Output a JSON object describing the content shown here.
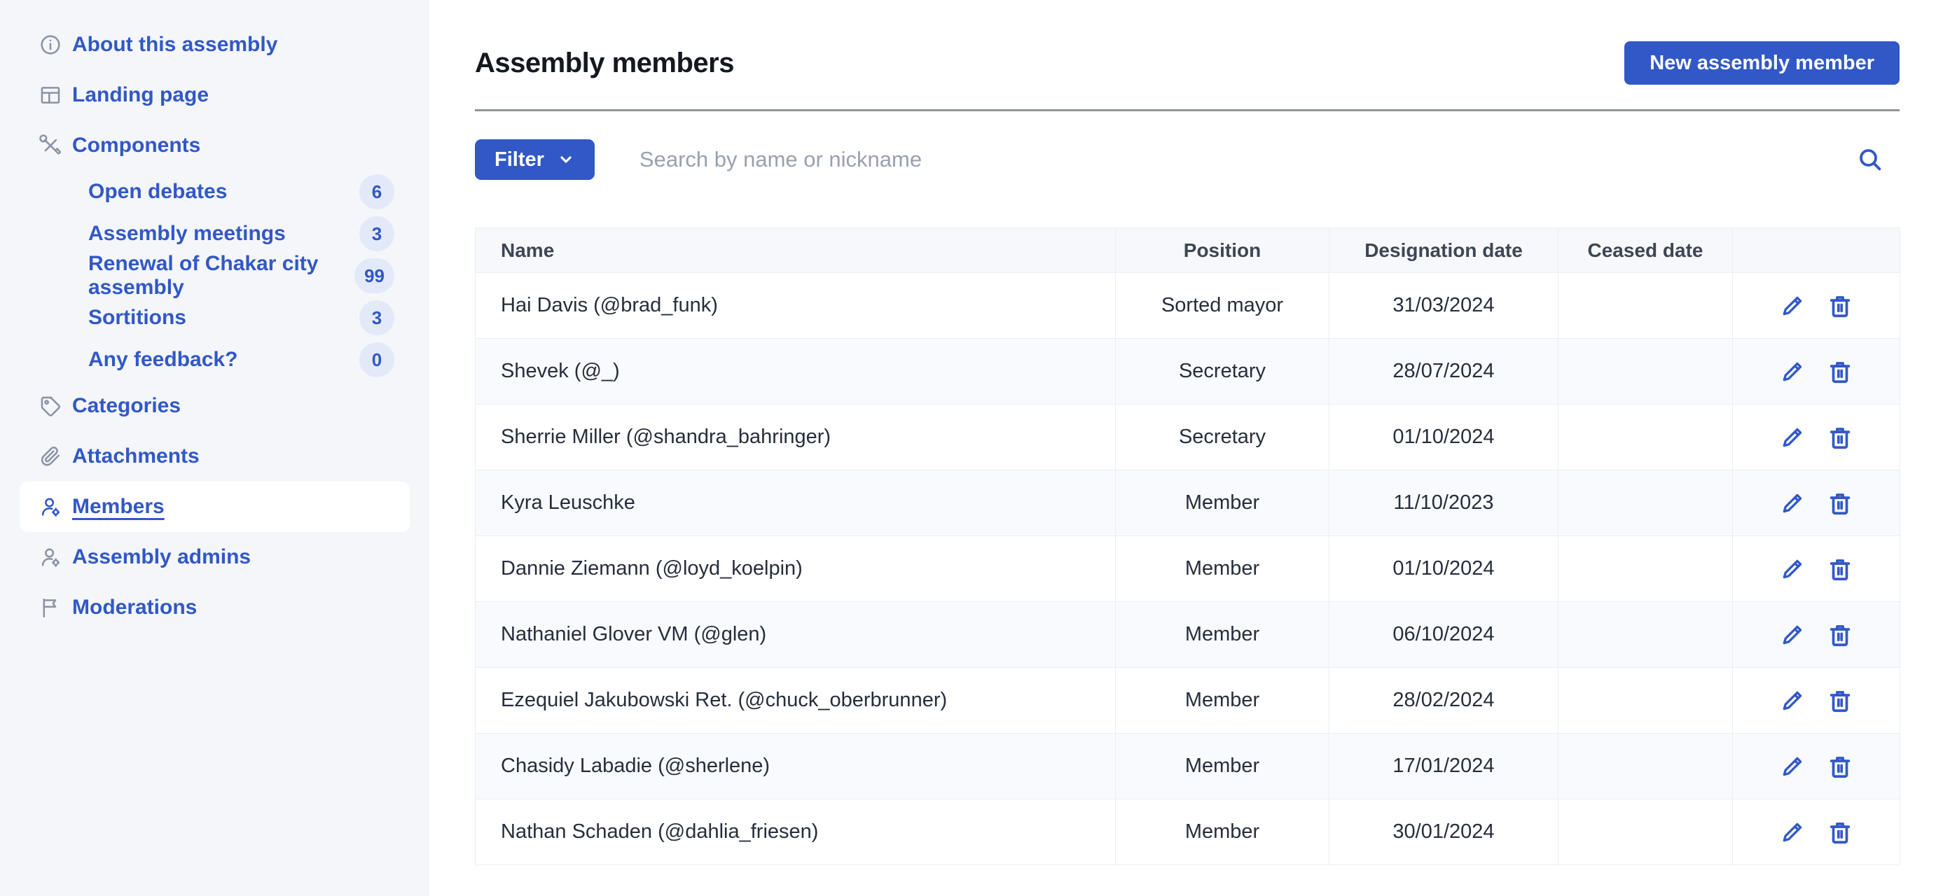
{
  "sidebar": {
    "items": [
      {
        "label": "About this assembly",
        "icon": "info-icon"
      },
      {
        "label": "Landing page",
        "icon": "landing-page-icon"
      },
      {
        "label": "Components",
        "icon": "tools-icon"
      },
      {
        "label": "Open debates",
        "badge": "6",
        "sub": true
      },
      {
        "label": "Assembly meetings",
        "badge": "3",
        "sub": true
      },
      {
        "label": "Renewal of Chakar city assembly",
        "badge": "99",
        "sub": true
      },
      {
        "label": "Sortitions",
        "badge": "3",
        "sub": true
      },
      {
        "label": "Any feedback?",
        "badge": "0",
        "sub": true
      },
      {
        "label": "Categories",
        "icon": "tag-icon"
      },
      {
        "label": "Attachments",
        "icon": "paperclip-icon"
      },
      {
        "label": "Members",
        "icon": "user-gear-icon",
        "active": true
      },
      {
        "label": "Assembly admins",
        "icon": "user-gear-icon"
      },
      {
        "label": "Moderations",
        "icon": "flag-icon"
      }
    ]
  },
  "header": {
    "title": "Assembly members",
    "new_button_label": "New assembly member"
  },
  "toolbar": {
    "filter_label": "Filter",
    "search_placeholder": "Search by name or nickname"
  },
  "table": {
    "columns": [
      "Name",
      "Position",
      "Designation date",
      "Ceased date",
      ""
    ],
    "rows": [
      {
        "name": "Hai Davis (@brad_funk)",
        "position": "Sorted mayor",
        "designation_date": "31/03/2024",
        "ceased_date": ""
      },
      {
        "name": "Shevek (@_)",
        "position": "Secretary",
        "designation_date": "28/07/2024",
        "ceased_date": ""
      },
      {
        "name": "Sherrie Miller (@shandra_bahringer)",
        "position": "Secretary",
        "designation_date": "01/10/2024",
        "ceased_date": ""
      },
      {
        "name": "Kyra Leuschke",
        "position": "Member",
        "designation_date": "11/10/2023",
        "ceased_date": ""
      },
      {
        "name": "Dannie Ziemann (@loyd_koelpin)",
        "position": "Member",
        "designation_date": "01/10/2024",
        "ceased_date": ""
      },
      {
        "name": "Nathaniel Glover VM (@glen)",
        "position": "Member",
        "designation_date": "06/10/2024",
        "ceased_date": ""
      },
      {
        "name": "Ezequiel Jakubowski Ret. (@chuck_oberbrunner)",
        "position": "Member",
        "designation_date": "28/02/2024",
        "ceased_date": ""
      },
      {
        "name": "Chasidy Labadie (@sherlene)",
        "position": "Member",
        "designation_date": "17/01/2024",
        "ceased_date": ""
      },
      {
        "name": "Nathan Schaden (@dahlia_friesen)",
        "position": "Member",
        "designation_date": "30/01/2024",
        "ceased_date": ""
      }
    ]
  },
  "icons": {
    "sidebar": [
      "info-icon",
      "landing-page-icon",
      "tools-icon",
      "tag-icon",
      "paperclip-icon",
      "user-gear-icon",
      "flag-icon"
    ],
    "toolbar": [
      "chevron-down-icon",
      "search-icon"
    ],
    "row_actions": [
      "pencil-icon",
      "trash-icon"
    ]
  },
  "colors": {
    "accent": "#3158c6",
    "sidebar_bg": "#f4f6f9",
    "badge_bg": "#e2eafa",
    "divider": "#8f959d",
    "table_header_bg": "#f6f8fb",
    "row_alt_bg": "#f8fafd",
    "table_border": "#e9eef6"
  }
}
